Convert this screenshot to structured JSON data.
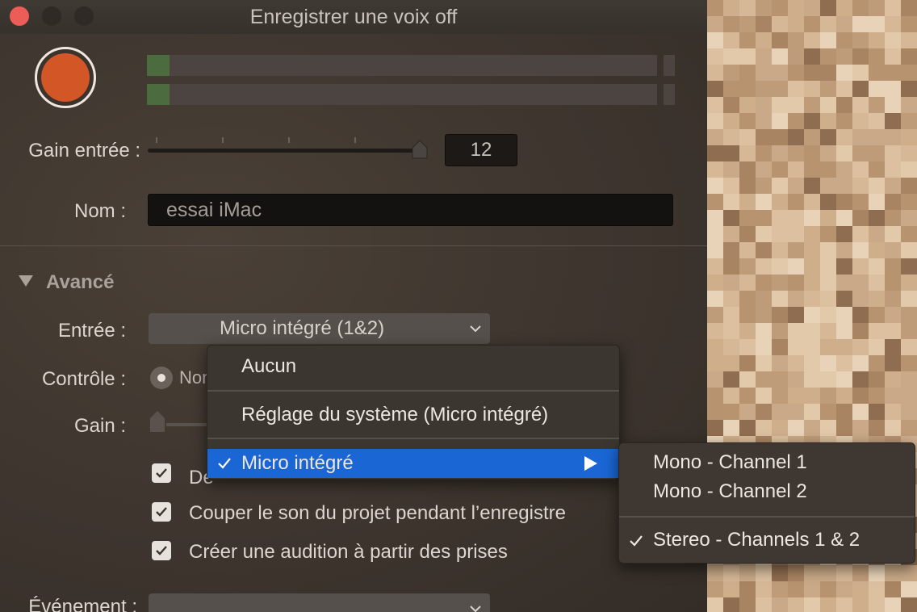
{
  "window": {
    "title": "Enregistrer une voix off"
  },
  "record": {
    "gain_label": "Gain entrée :",
    "gain_value": "12",
    "gain_level": 0.985
  },
  "name": {
    "label": "Nom :",
    "value": "essai iMac"
  },
  "advanced": {
    "label": "Avancé",
    "input_label": "Entrée :",
    "input_value": "Micro intégré (1&2)",
    "monitor_label": "Contrôle :",
    "monitor_option": "Non",
    "monitor_gain_label": "Gain :",
    "checkboxes": [
      {
        "label": "De",
        "checked": true
      },
      {
        "label": "Couper le son du projet pendant l’enregistre",
        "checked": true
      },
      {
        "label": "Créer une audition à partir des prises",
        "checked": true
      }
    ],
    "event_label": "Événement :"
  },
  "input_menu": {
    "items": [
      "Aucun",
      "Réglage du système (Micro intégré)",
      "Micro intégré"
    ],
    "selected_index": 2,
    "submenu": [
      "Mono - Channel 1",
      "Mono - Channel 2",
      "Stereo - Channels 1 & 2"
    ],
    "submenu_checked_index": 2
  },
  "colors": {
    "record": "#d35627",
    "selection": "#1a66d4",
    "meter_level": "#4c6c3f"
  },
  "icons": [
    "close-icon",
    "minimize-icon",
    "maximize-icon",
    "record-icon",
    "disclosure-triangle-icon",
    "chevron-down-icon",
    "checkmark-icon",
    "submenu-arrow-icon"
  ]
}
